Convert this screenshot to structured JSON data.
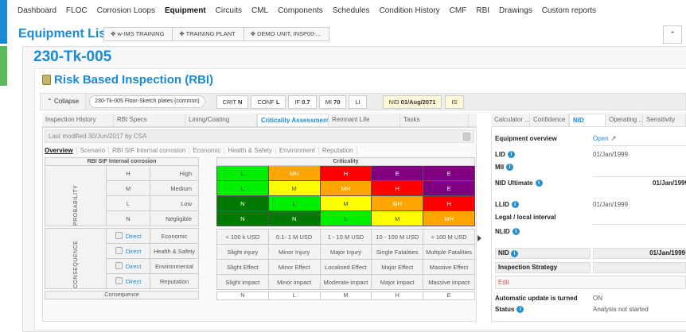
{
  "nav": [
    "Dashboard",
    "FLOC",
    "Corrosion Loops",
    "Equipment",
    "Circuits",
    "CML",
    "Components",
    "Schedules",
    "Condition History",
    "CMF",
    "RBI",
    "Drawings",
    "Custom reports"
  ],
  "nav_active": "Equipment",
  "page_title": "Equipment List",
  "breadcrumbs": [
    "w-IMS TRAINING",
    "TRAINING PLANT",
    "DEMO UNIT, INSP00-..."
  ],
  "equipment_tag": "230-Tk-005",
  "section_title": "Risk Based Inspection (RBI)",
  "toolbar": {
    "collapse": "Collapse",
    "scenario": "230-Tk-005 Floor-Sketch plates (common)",
    "chips": [
      [
        "CRIT",
        "N"
      ],
      [
        "CONF",
        "L"
      ],
      [
        "IF",
        "0.7"
      ],
      [
        "MI",
        "70"
      ],
      [
        "LI",
        ""
      ]
    ],
    "nid": [
      "NID",
      "01/Aug/2071"
    ],
    "is": "IS"
  },
  "tabs": [
    "Inspection History",
    "RBI Specs",
    "Lining/Coating",
    "Criticality Assessment",
    "Remnant Life",
    "Tasks"
  ],
  "active_tab": "Criticality Assessment",
  "last_modified": "Last modified 30/Jun/2017 by CSA",
  "subtabs": [
    "Overview",
    "Scenario",
    "RBI StF Internal corrosion",
    "Economic",
    "Health & Safety",
    "Environment",
    "Reputation"
  ],
  "left_table": {
    "header": "RBI StF Internal corrosion",
    "probability_label": "PROBABILITY",
    "probability": [
      [
        "H",
        "High"
      ],
      [
        "M",
        "Medium"
      ],
      [
        "L",
        "Low"
      ],
      [
        "N",
        "Negligible"
      ]
    ],
    "consequence_label": "CONSEQUENCE",
    "direct_label": "Direct",
    "consequence": [
      "Economic",
      "Health & Safety",
      "Environmental",
      "Reputation"
    ],
    "footer": "Consequence"
  },
  "matrix": {
    "header": "Criticality",
    "rows": [
      [
        "L",
        "MH",
        "H",
        "E",
        "E"
      ],
      [
        "L",
        "M",
        "MH",
        "H",
        "E"
      ],
      [
        "N",
        "L",
        "M",
        "MH",
        "H"
      ],
      [
        "N",
        "N",
        "L",
        "M",
        "MH"
      ]
    ],
    "consequence_rows": [
      [
        "< 100 k USD",
        "0.1- 1 M USD",
        "1 - 10 M USD",
        "10 - 100 M USD",
        "> 100 M USD"
      ],
      [
        "Slight injury",
        "Minor Injury",
        "Major Injury",
        "Single Fatalities",
        "Multiple Fatalities"
      ],
      [
        "Slight Effect",
        "Minor Effect",
        "Localised Effect",
        "Major Effect",
        "Massive Effect"
      ],
      [
        "Slight impact",
        "Minor impact",
        "Moderate impact",
        "Major impact",
        "Massive impact"
      ]
    ],
    "footer": [
      "N",
      "L",
      "M",
      "H",
      "E"
    ]
  },
  "colors": {
    "N": "#007a00",
    "L": "#00ee00",
    "M": "#ffff00",
    "MH": "#ffa500",
    "H": "#ff0000",
    "E": "#800080",
    "accent": "#1a8ad4"
  },
  "right": {
    "tabs": [
      "Calculator ...",
      "Confidence",
      "NID",
      "Operating ...",
      "Sensitivity"
    ],
    "active_tab": "NID",
    "equipment_overview": "Equipment overview",
    "open": "Open",
    "lid": "LID",
    "lid_val": "01/Jan/1999",
    "mii": "MII",
    "nid_ultimate": "NID Ultimate",
    "nid_ultimate_val": "01/Jan/1999",
    "llid": "LLID",
    "llid_val": "01/Jan/1999",
    "legal": "Legal / local interval",
    "nlid": "NLID",
    "nid": "NID",
    "nid_val": "01/Jan/1999",
    "strategy": "Inspection Strategy",
    "edit": "Edit",
    "auto": "Automatic update is turned",
    "auto_val": "ON",
    "status": "Status",
    "status_val": "Analysis not started"
  }
}
